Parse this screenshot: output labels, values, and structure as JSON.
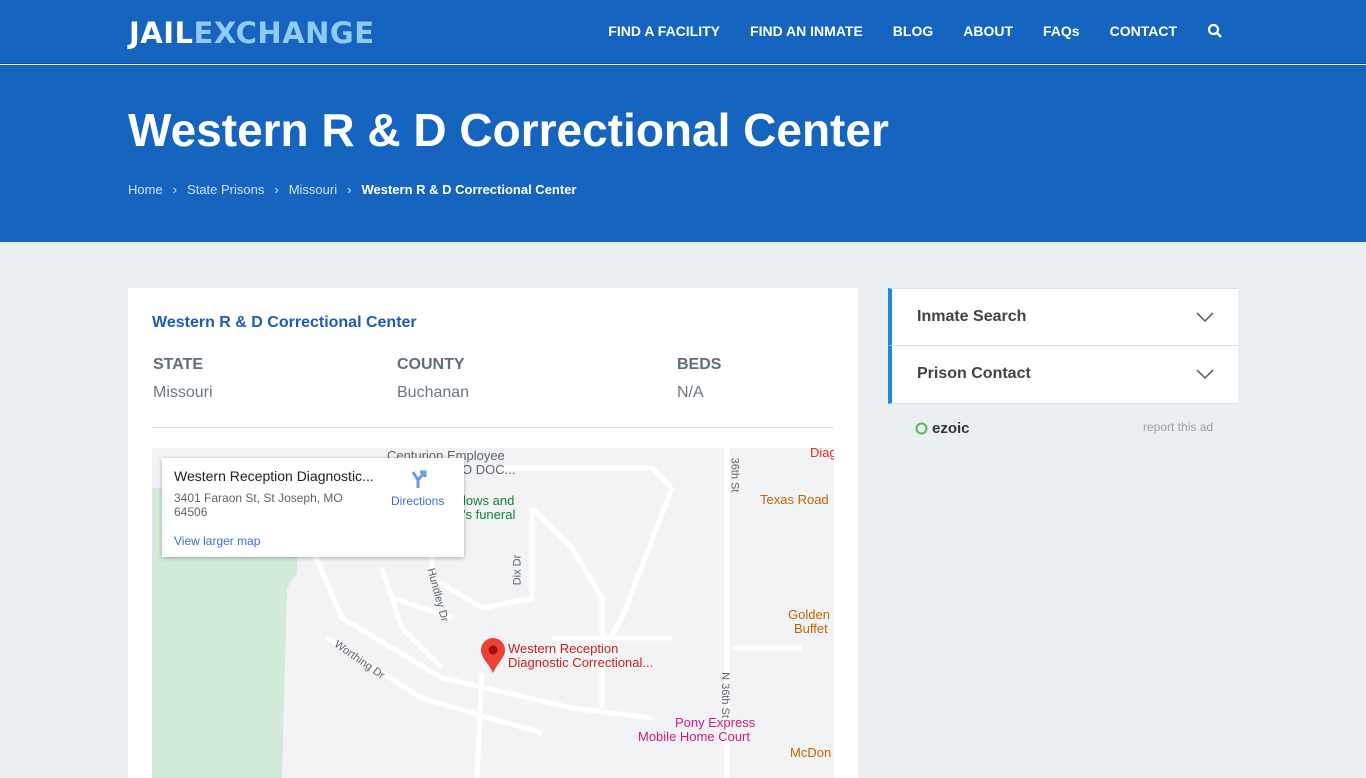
{
  "nav": {
    "logo_part1": "JAIL",
    "logo_part2": "EXCHANGE",
    "items": [
      "FIND A FACILITY",
      "FIND AN INMATE",
      "BLOG",
      "ABOUT",
      "FAQs",
      "CONTACT"
    ],
    "search_icon": "search-icon"
  },
  "hero": {
    "title": "Western R & D Correctional Center",
    "breadcrumbs": [
      "Home",
      "State Prisons",
      "Missouri"
    ],
    "current": "Western R & D Correctional Center"
  },
  "facility": {
    "name": "Western R & D Correctional Center",
    "state_label": "STATE",
    "state": "Missouri",
    "county_label": "COUNTY",
    "county": "Buchanan",
    "beds_label": "BEDS",
    "beds": "N/A"
  },
  "map": {
    "info_title": "Western Reception Diagnostic...",
    "address1": "3401 Faraon St, St Joseph, MO",
    "address2": "64506",
    "directions": "Directions",
    "larger": "View larger map",
    "labels": {
      "centurion1": "Centurion Employee",
      "centurion2": "t MO DOC...",
      "lows1": "lows and",
      "lows2": "'s funeral",
      "st36": "36th St",
      "diag": "Diag",
      "texas": "Texas Road",
      "hundley": "Hundley Dr",
      "dix": "Dix Dr",
      "golden1": "Golden",
      "golden2": "Buffet",
      "pin1": "Western Reception",
      "pin2": "Diagnostic Correctional...",
      "worthing": "Worthing Dr",
      "n36": "N 36th St",
      "pony1": "Pony Express",
      "pony2": "Mobile Home Court",
      "mcd": "McDon"
    }
  },
  "sidebar": {
    "items": [
      "Inmate Search",
      "Prison Contact"
    ],
    "ad_brand": "ezoic",
    "report": "report this ad"
  }
}
